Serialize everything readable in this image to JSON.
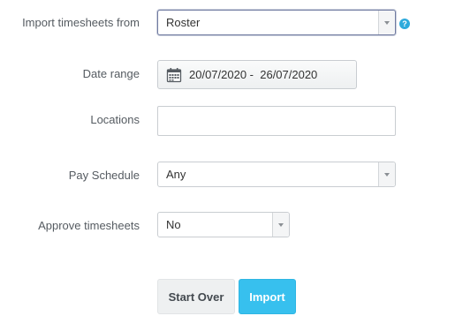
{
  "form": {
    "import_from": {
      "label": "Import timesheets from",
      "value": "Roster"
    },
    "help_icon": {
      "glyph": "?"
    },
    "date_range": {
      "label": "Date range",
      "value": "20/07/2020 -  26/07/2020"
    },
    "locations": {
      "label": "Locations",
      "value": "",
      "placeholder": ""
    },
    "pay_schedule": {
      "label": "Pay Schedule",
      "value": "Any"
    },
    "approve_timesheets": {
      "label": "Approve timesheets",
      "value": "No"
    }
  },
  "actions": {
    "start_over_label": "Start Over",
    "import_label": "Import"
  },
  "colors": {
    "primary": "#37c0ee",
    "help_icon": "#2eaadc",
    "label_text": "#555b61"
  }
}
